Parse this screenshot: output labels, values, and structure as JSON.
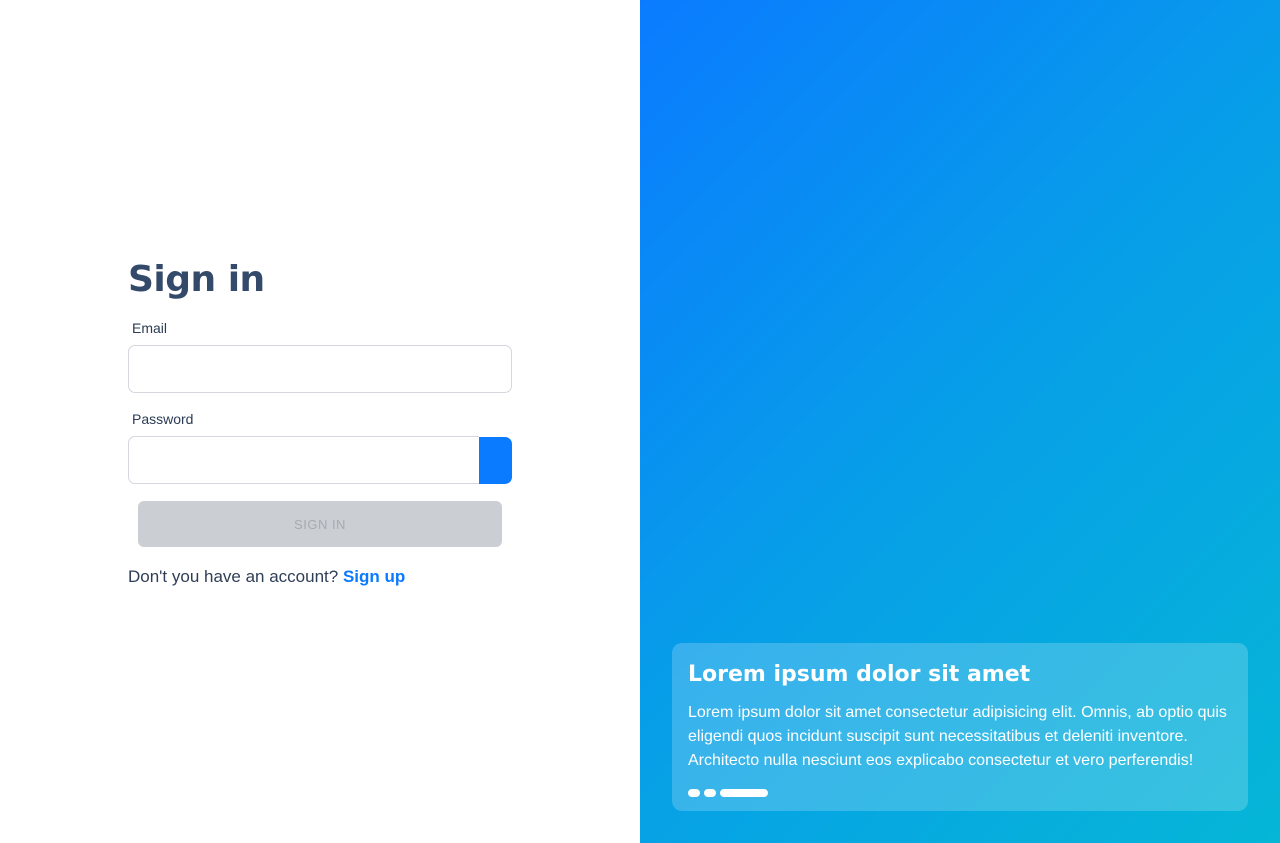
{
  "form": {
    "title": "Sign in",
    "email_label": "Email",
    "email_value": "",
    "email_placeholder": "",
    "password_label": "Password",
    "password_value": "",
    "password_placeholder": "",
    "submit_label": "SIGN IN",
    "signup_prompt": "Don't you have an account? ",
    "signup_link": "Sign up"
  },
  "colors": {
    "accent": "#0a7bff",
    "title": "#334a6b",
    "disabled_button": "#cbced3"
  },
  "hero": {
    "card_title": "Lorem ipsum dolor sit amet",
    "card_text": "Lorem ipsum dolor sit amet consectetur adipisicing elit. Omnis, ab optio quis eligendi quos incidunt suscipit sunt necessitatibus et deleniti inventore. Architecto nulla nesciunt eos explicabo consectetur et vero perferendis!",
    "slides_count": 3,
    "active_slide": 3
  },
  "icons": {
    "password_toggle": "eye-icon"
  }
}
